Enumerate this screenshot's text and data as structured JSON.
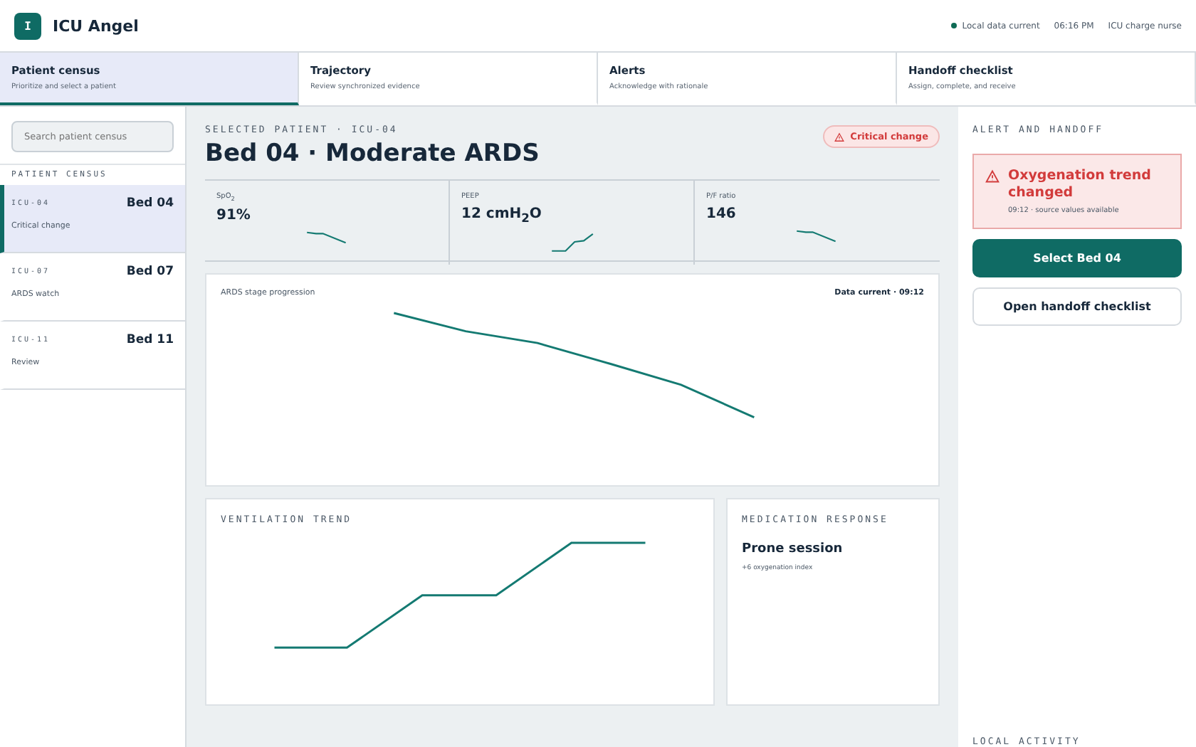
{
  "app": {
    "logo_letter": "I",
    "title": "ICU Angel"
  },
  "status": {
    "data_status": "Local data current",
    "time": "06:16 PM",
    "role": "ICU charge nurse"
  },
  "tabs": [
    {
      "label": "Patient census",
      "hint": "Prioritize and select a patient",
      "selected": true
    },
    {
      "label": "Trajectory",
      "hint": "Review synchronized evidence",
      "selected": false
    },
    {
      "label": "Alerts",
      "hint": "Acknowledge with rationale",
      "selected": false
    },
    {
      "label": "Handoff checklist",
      "hint": "Assign, complete, and receive",
      "selected": false
    }
  ],
  "sidebar": {
    "search": {
      "placeholder": "Search patient census"
    },
    "heading": "PATIENT CENSUS",
    "patients": [
      {
        "id": "ICU-04",
        "bed": "Bed 04",
        "status": "Critical change",
        "selected": true
      },
      {
        "id": "ICU-07",
        "bed": "Bed 07",
        "status": "ARDS watch",
        "selected": false
      },
      {
        "id": "ICU-11",
        "bed": "Bed 11",
        "status": "Review",
        "selected": false
      }
    ]
  },
  "main": {
    "eyebrow": "SELECTED PATIENT · ICU-04",
    "title": "Bed 04 · Moderate ARDS",
    "badge": "Critical change",
    "vitals": [
      {
        "label": "SpO$_{2}$",
        "value": "91%",
        "kind": "falling"
      },
      {
        "label": "PEEP",
        "value": "12 cmH$_{2}$O",
        "kind": "rising"
      },
      {
        "label": "P/F ratio",
        "value": "146",
        "kind": "falling"
      }
    ],
    "progression": {
      "title": "ARDS stage progression",
      "freshness": "Data current · 09:12"
    },
    "ventilation": {
      "title": "VENTILATION TREND"
    },
    "medication": {
      "title": "MEDICATION RESPONSE",
      "name": "Prone session",
      "detail": "+6 oxygenation index"
    }
  },
  "panel": {
    "heading": "ALERT AND HANDOFF",
    "alert": {
      "title": "Oxygenation trend changed",
      "detail": "09:12 · source values available"
    },
    "buttons": [
      {
        "label": "Select Bed 04",
        "kind": "primary"
      },
      {
        "label": "Open handoff checklist",
        "kind": "secondary"
      }
    ],
    "activity_heading": "LOCAL ACTIVITY"
  }
}
